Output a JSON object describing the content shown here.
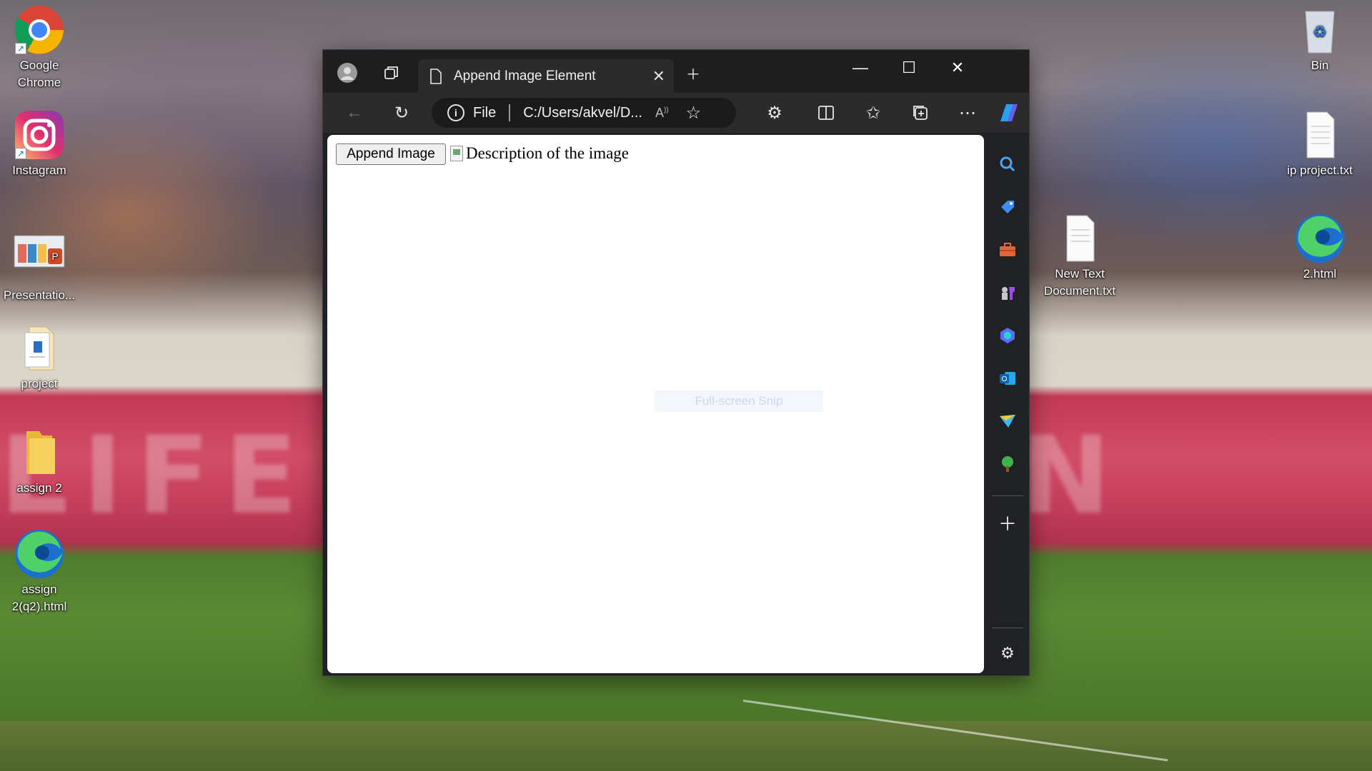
{
  "desktop": {
    "left_icons": [
      {
        "label": "Google Chrome",
        "icon": "chrome-icon"
      },
      {
        "label": "Instagram",
        "icon": "instagram-icon"
      },
      {
        "label": "Presentatio...",
        "icon": "powerpoint-file-icon"
      },
      {
        "label": "project",
        "icon": "document-file-icon"
      },
      {
        "label": "assign 2",
        "icon": "folder-icon"
      },
      {
        "label": "assign 2(q2).html",
        "icon": "edge-icon"
      }
    ],
    "right_icons": [
      {
        "label": "Bin",
        "icon": "recycle-bin-icon"
      },
      {
        "label": "ip project.txt",
        "icon": "text-file-icon"
      },
      {
        "label": "2.html",
        "icon": "edge-icon"
      },
      {
        "label": "New Text Document.txt",
        "icon": "text-file-icon"
      }
    ],
    "background_text": "LIFE IN  NOW IN"
  },
  "browser": {
    "tab_title": "Append Image Element",
    "address_scheme": "File",
    "address_url": "C:/Users/akvel/D...",
    "page": {
      "button_label": "Append Image",
      "image_alt": "Description of the image"
    },
    "overlay_hint": "Full-screen Snip"
  }
}
